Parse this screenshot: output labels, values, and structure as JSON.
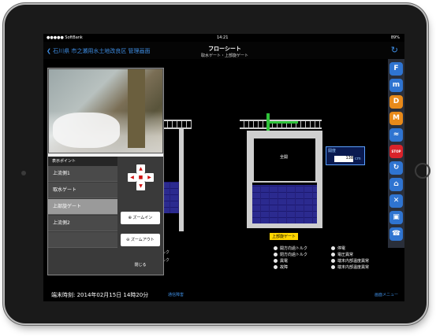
{
  "status_bar": {
    "carrier": "●●●●● SoftBank",
    "time": "14:21",
    "battery": "89%"
  },
  "navbar": {
    "back_label": "石川県 市之瀬用水土地改良区 管理画面",
    "title": "フローシート",
    "subtitle": "取水ゲート・上部旋ゲート"
  },
  "popover": {
    "section_header": "表示ポイント",
    "points": [
      {
        "label": "上流側1"
      },
      {
        "label": "取水ゲート"
      },
      {
        "label": "上部旋ゲート"
      },
      {
        "label": "上流側2"
      }
    ],
    "selected_index": 2,
    "zoom_in": "ズームイン",
    "zoom_out": "ズームアウト",
    "close": "閉じる"
  },
  "gate": {
    "name_tag": "上部旋ゲート",
    "status": "全開",
    "opening_label": "開度",
    "opening_value": "138",
    "opening_unit": "cm"
  },
  "legend_left": [
    "ルク",
    "ルク"
  ],
  "legend_center": [
    "開方向過トルク",
    "閉方向過トルク",
    "異電",
    "故障"
  ],
  "legend_right": [
    "停電",
    "電圧異常",
    "端末内部温度異常",
    "端末内部温度異常"
  ],
  "footer": {
    "time_text": "端末時刻: 2014年02月15日 14時20分",
    "link_left": "通信障害",
    "link_right": "画面メニュー"
  },
  "side_buttons": [
    {
      "label": "F",
      "color": "#2f74d0"
    },
    {
      "label": "m",
      "color": "#2f74d0"
    },
    {
      "label": "D",
      "color": "#e88a1a"
    },
    {
      "label": "M",
      "color": "#e88a1a"
    },
    {
      "label": "≈",
      "color": "#2f74d0"
    },
    {
      "label": "STOP",
      "color": "#d9232a"
    },
    {
      "label": "↻",
      "color": "#2f74d0"
    },
    {
      "label": "⌂",
      "color": "#2f74d0"
    },
    {
      "label": "✕",
      "color": "#2f74d0"
    },
    {
      "label": "▣",
      "color": "#2f74d0"
    },
    {
      "label": "☎",
      "color": "#2f74d0"
    }
  ]
}
